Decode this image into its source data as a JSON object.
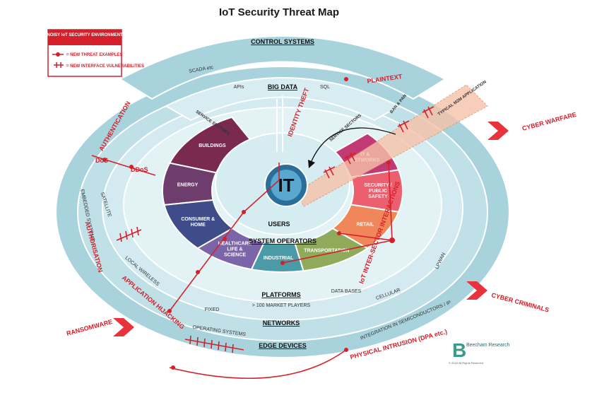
{
  "title": "IoT Security Threat Map",
  "legend": {
    "heading": "NOISY IoT SECURITY ENVIRONMENT",
    "threat_label": "= NEW THREAT EXAMPLES",
    "vuln_label": "= NEW INTERFACE VULNERABILITIES"
  },
  "layers": {
    "control_systems": "CONTROL SYSTEMS",
    "scada": "SCADA etc",
    "big_data": "BIG DATA",
    "apis": "APIs",
    "sql": "SQL",
    "users": "USERS",
    "system_operators": "SYSTEM OPERATORS",
    "platforms": "PLATFORMS",
    "market_players": "> 100 MARKET PLAYERS",
    "networks": "NETWORKS",
    "edge_devices": "EDGE DEVICES",
    "center": "IT"
  },
  "sectors": [
    {
      "label": "BUILDINGS",
      "color": "#7a2a4f"
    },
    {
      "label": "ENERGY",
      "color": "#6e3d6e"
    },
    {
      "label": "CONSUMER & HOME",
      "color": "#3f4c8a"
    },
    {
      "label": "HEALTHCARE LIFE & SCIENCE",
      "color": "#7b64a8"
    },
    {
      "label": "INDUSTRIAL",
      "color": "#4a9aa8"
    },
    {
      "label": "TRANSPORTATION",
      "color": "#8eaa5a"
    },
    {
      "label": "RETAIL",
      "color": "#f0875a"
    },
    {
      "label": "SECURITY / PUBLIC SAFETY",
      "color": "#ec5f6e"
    },
    {
      "label": "IT & NETWORKS",
      "color": "#c23a73"
    }
  ],
  "service_sectors": "SERVICE SECTORS",
  "networks_items": [
    "SATELLITE",
    "LOCAL WIRELESS",
    "FIXED",
    "CELLULAR",
    "LPWAN"
  ],
  "edge_items": [
    "EMBEDDED SYSTEMS",
    "OPERATING SYSTEMS",
    "INTEGRATION IN SEMICONDUCTORS / IP"
  ],
  "platform_items": [
    "DATA BASES"
  ],
  "ban_pan": "BAN & PAN",
  "m2m": "TYPICAL M2M APPLICATION",
  "threats": {
    "plaintext": "PLAINTEXT",
    "identity_theft": "IDENTITY THEFT",
    "authentication": "AUTHENTICATION",
    "dos": "DoS",
    "ddos": "DDoS",
    "authorisation": "AUTHORISATION",
    "application_hijacking": "APPLICATION HIJACKING",
    "inter_sector": "IoT INTER-SECTOR INTERACTIONS",
    "physical_intrusion": "PHYSICAL INTRUSION (DPA etc.)"
  },
  "external_threats": {
    "cyber_warfare": "CYBER WARFARE",
    "cyber_criminals": "CYBER CRIMINALS",
    "ransomware": "RANSOMWARE"
  },
  "brand": {
    "name": "Beecham Research",
    "copyright": "© 2015 All Rights Reserved"
  },
  "colors": {
    "outer_ring": "#a9d3dc",
    "mid_ring": "#c9e4ea",
    "inner_ring": "#ddeff3",
    "threat_red": "#d4202a",
    "m2m_band": "#f6c2a8"
  }
}
